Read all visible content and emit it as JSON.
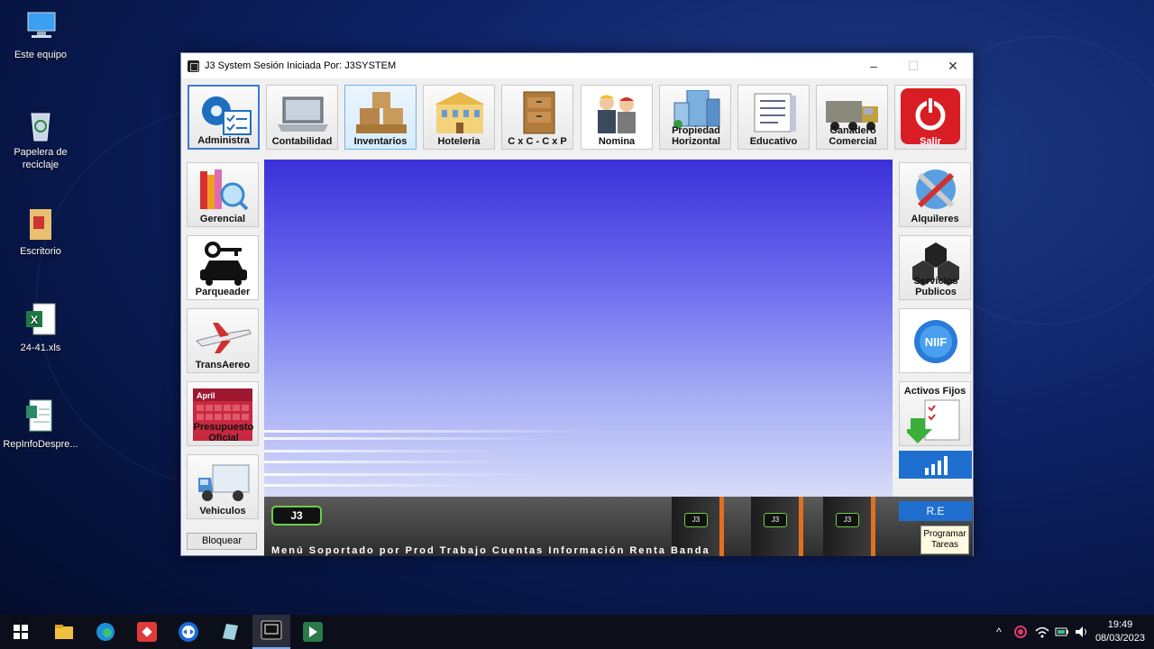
{
  "desktop": {
    "icons": [
      {
        "label": "Este equipo"
      },
      {
        "label": "Papelera de reciclaje"
      },
      {
        "label": "Escritorio"
      },
      {
        "label": "24-41.xls"
      },
      {
        "label": "RepInfoDespre..."
      }
    ]
  },
  "window": {
    "title": "J3 System Sesión Iniciada Por:  J3SYSTEM",
    "controls": {
      "minimize": "–",
      "maximize": "☐",
      "close": "✕"
    }
  },
  "top_modules": [
    {
      "label": "Administra"
    },
    {
      "label": "Contabilidad"
    },
    {
      "label": "Inventarios"
    },
    {
      "label": "Hoteleria"
    },
    {
      "label": "C x C - C x P"
    },
    {
      "label": "Nomina"
    },
    {
      "label": "Propiedad Horizontal"
    },
    {
      "label": "Educativo"
    },
    {
      "label": "Ganadero Comercial"
    },
    {
      "label": "Salir"
    }
  ],
  "left_modules": [
    {
      "label": "Gerencial"
    },
    {
      "label": "Parqueader"
    },
    {
      "label": "TransAereo"
    },
    {
      "label": "Presupuesto Oficial",
      "calendar_text": "April"
    },
    {
      "label": "Vehiculos"
    }
  ],
  "right_modules": [
    {
      "label": "Alquileres"
    },
    {
      "label": "Servicios Publicos"
    },
    {
      "label": "NIIF"
    },
    {
      "label": "Activos Fijos"
    }
  ],
  "buttons": {
    "lock": "Bloquear",
    "re": "R.E",
    "schedule": "Programar Tareas"
  },
  "banner": {
    "logo": "J3",
    "ticker": "Menú  Soportado  por  Prod  Trabajo  Cuentas  Información  Renta  Banda"
  },
  "taskbar": {
    "time": "19:49",
    "date": "08/03/2023"
  }
}
